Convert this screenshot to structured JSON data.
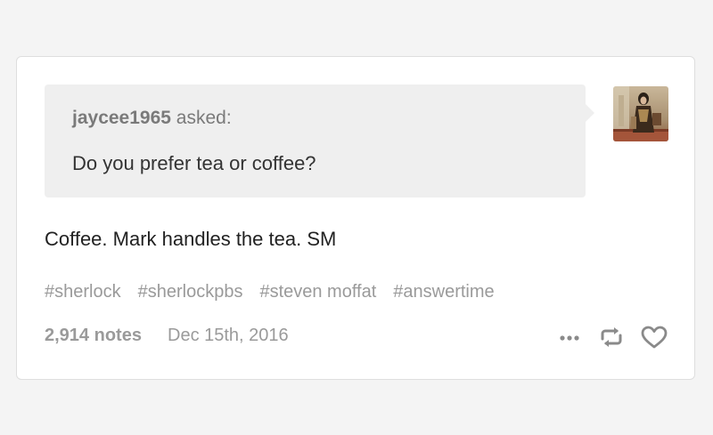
{
  "post": {
    "asker": {
      "name": "jaycee1965",
      "verb": "asked:"
    },
    "question": "Do you prefer tea or coffee?",
    "answer": "Coffee. Mark handles the tea. SM",
    "tags": [
      "#sherlock",
      "#sherlockpbs",
      "#steven moffat",
      "#answertime"
    ],
    "notes": "2,914 notes",
    "date": "Dec 15th, 2016",
    "actions": {
      "more_icon": "more-dots-icon",
      "reblog_icon": "reblog-icon",
      "like_icon": "heart-icon"
    },
    "colors": {
      "background": "#f4f4f4",
      "card": "#ffffff",
      "bubble": "#efefef",
      "meta_text": "#9a9a9a",
      "body_text": "#222222"
    }
  }
}
